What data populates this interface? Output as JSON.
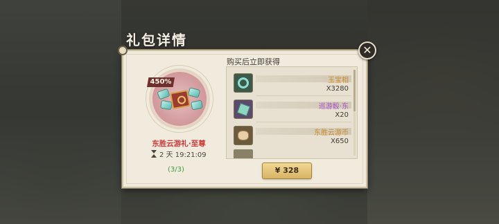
{
  "dialog": {
    "title": "礼包详情",
    "close_icon": "close-icon"
  },
  "gift": {
    "percent_badge": "450%",
    "name": "东胜云游礼·至尊",
    "timer": "2 天 19:21:09",
    "purchase_limit": "(3/3)"
  },
  "rewards": {
    "header": "购买后立即获得",
    "items": [
      {
        "name": "玉宝相",
        "qty": "X3280",
        "name_color": "#c98a2a",
        "icon": "jade-token-icon",
        "icon_bg": "#3c5a4a"
      },
      {
        "name": "巡游骰·东",
        "qty": "X20",
        "name_color": "#a24fc4",
        "icon": "dice-icon",
        "icon_bg": "#5a4a6c"
      },
      {
        "name": "东胜云游币",
        "qty": "X650",
        "name_color": "#c98a2a",
        "icon": "coin-icon",
        "icon_bg": "#6c5a3c"
      }
    ]
  },
  "purchase": {
    "price_label": "¥ 328"
  }
}
